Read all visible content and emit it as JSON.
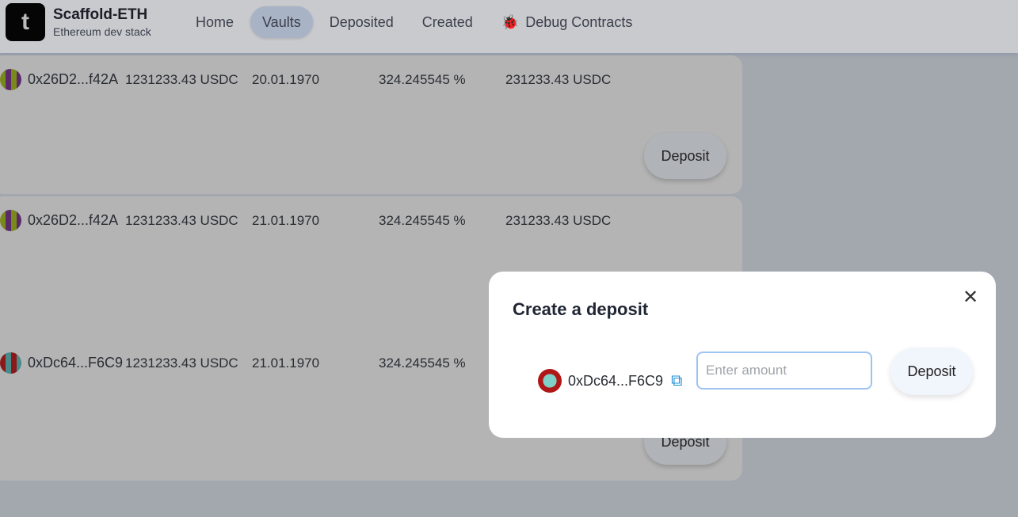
{
  "header": {
    "logo_text": "t",
    "title": "Scaffold-ETH",
    "subtitle": "Ethereum dev stack",
    "nav": [
      {
        "label": "Home"
      },
      {
        "label": "Vaults",
        "active": true
      },
      {
        "label": "Deposited"
      },
      {
        "label": "Created"
      },
      {
        "label": "Debug Contracts",
        "icon": "bug-icon"
      }
    ]
  },
  "vaults": [
    {
      "address": "0x26D2...f42A",
      "amount": "1231233.43 USDC",
      "date": "20.01.1970",
      "rate": "324.245545 %",
      "total": "231233.43 USDC",
      "button": "Deposit"
    },
    {
      "address": "0x26D2...f42A",
      "amount": "1231233.43 USDC",
      "date": "21.01.1970",
      "rate": "324.245545 %",
      "total": "231233.43 USDC"
    },
    {
      "address": "0xDc64...F6C9",
      "amount": "1231233.43 USDC",
      "date": "21.01.1970",
      "rate": "324.245545 %",
      "button": "Deposit"
    }
  ],
  "modal": {
    "title": "Create a deposit",
    "close": "✕",
    "address": "0xDc64...F6C9",
    "input_placeholder": "Enter amount",
    "input_value": "",
    "button": "Deposit"
  }
}
